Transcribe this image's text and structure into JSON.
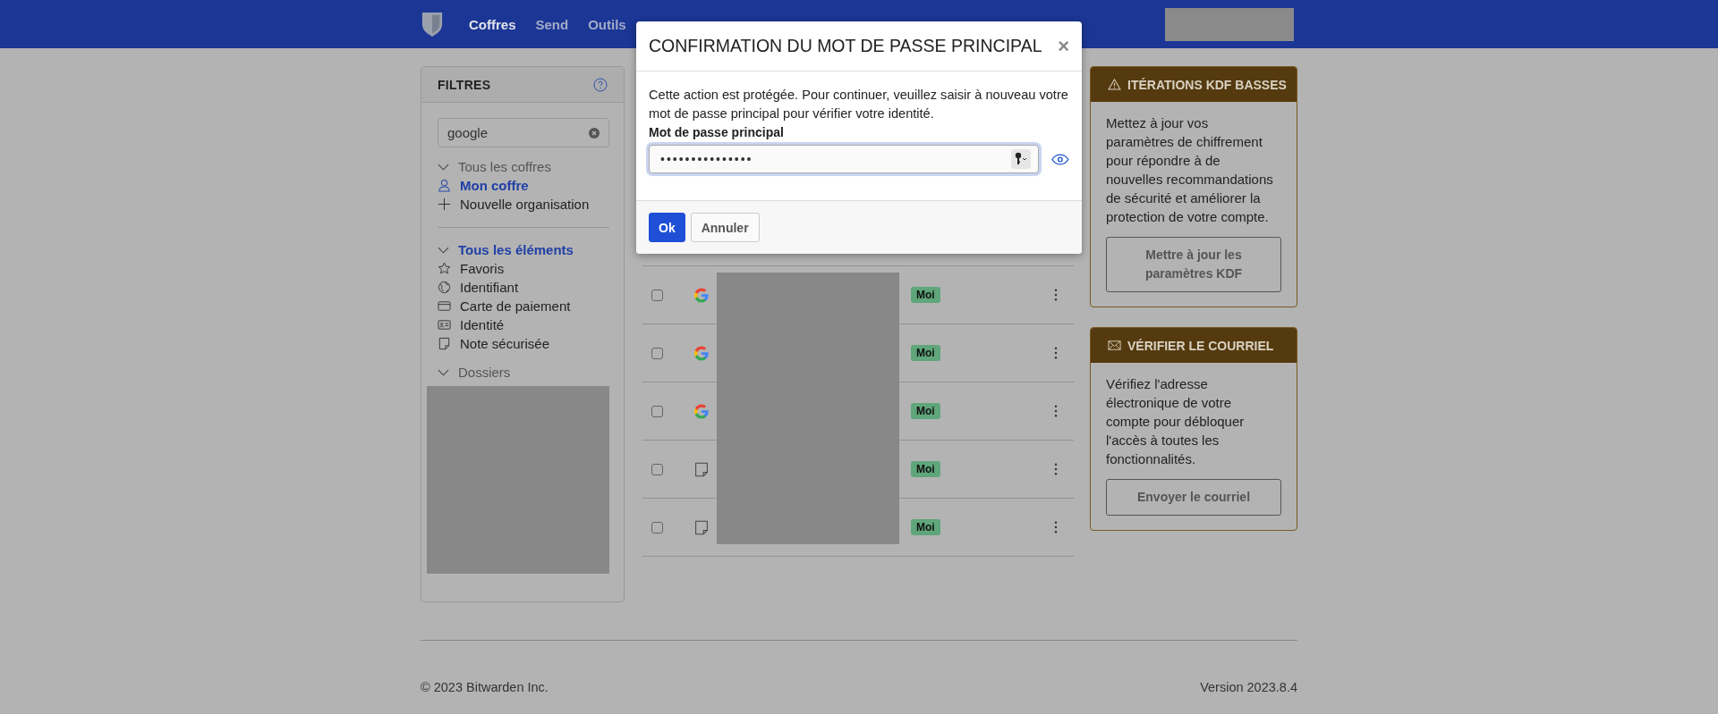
{
  "header": {
    "nav": [
      {
        "label": "Coffres",
        "selected": true
      },
      {
        "label": "Send",
        "selected": false
      },
      {
        "label": "Outils",
        "selected": false
      }
    ]
  },
  "filters": {
    "title": "FILTRES",
    "search": {
      "value": "google"
    },
    "vaults": {
      "label": "Tous les coffres",
      "expanded": true,
      "items": [
        {
          "label": "Mon coffre",
          "kind": "person",
          "selected": true
        },
        {
          "label": "Nouvelle organisation",
          "kind": "plus",
          "selected": false
        }
      ]
    },
    "types": {
      "label": "Tous les éléments",
      "expanded": true,
      "selected": true,
      "items": [
        {
          "label": "Favoris",
          "kind": "star",
          "selected": false
        },
        {
          "label": "Identifiant",
          "kind": "globe",
          "selected": false
        },
        {
          "label": "Carte de paiement",
          "kind": "card",
          "selected": false
        },
        {
          "label": "Identité",
          "kind": "id",
          "selected": false
        },
        {
          "label": "Note sécurisée",
          "kind": "note",
          "selected": false
        }
      ]
    },
    "folders": {
      "label": "Dossiers",
      "expanded": true
    }
  },
  "table": {
    "rows": [
      {
        "kind": "login",
        "checked": false,
        "owner": "Moi"
      },
      {
        "kind": "login",
        "checked": false,
        "owner": "Moi"
      },
      {
        "kind": "login",
        "checked": false,
        "owner": "Moi"
      },
      {
        "kind": "note",
        "checked": false,
        "owner": "Moi"
      },
      {
        "kind": "note",
        "checked": false,
        "owner": "Moi"
      }
    ]
  },
  "cards": [
    {
      "kind": "warning",
      "title": "ITÉRATIONS KDF BASSES",
      "text": "Mettez à jour vos paramètres de chiffrement pour répondre à de nouvelles recommandations de sécurité et améliorer la protection de votre compte.",
      "button": "Mettre à jour les paramètres KDF"
    },
    {
      "kind": "mail",
      "title": "VÉRIFIER LE COURRIEL",
      "text": "Vérifiez l'adresse électronique de votre compte pour débloquer l'accès à toutes les fonctionnalités.",
      "button": "Envoyer le courriel"
    }
  ],
  "footer": {
    "copyright": "© 2023 Bitwarden Inc.",
    "version": "Version 2023.8.4"
  },
  "dialog": {
    "title": "CONFIRMATION DU MOT DE PASSE PRINCIPAL",
    "close": "×",
    "text": "Cette action est protégée. Pour continuer, veuillez saisir à nouveau votre mot de passe principal pour vérifier votre identité.",
    "label": "Mot de passe principal",
    "password": "•••••••••••••••",
    "buttons": [
      {
        "label": "Ok",
        "kind": "primary"
      },
      {
        "label": "Annuler",
        "kind": "secondary"
      }
    ]
  }
}
